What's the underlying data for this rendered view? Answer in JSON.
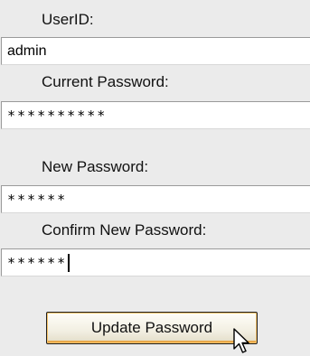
{
  "form": {
    "userid_label": "UserID:",
    "userid_value": "admin",
    "current_password_label": "Current Password:",
    "current_password_value": "**********",
    "new_password_label": "New Password:",
    "new_password_value": "******",
    "confirm_password_label": "Confirm New Password:",
    "confirm_password_value": "******",
    "update_button_label": "Update Password"
  },
  "icons": {
    "cursor": "arrow-pointer-icon"
  }
}
